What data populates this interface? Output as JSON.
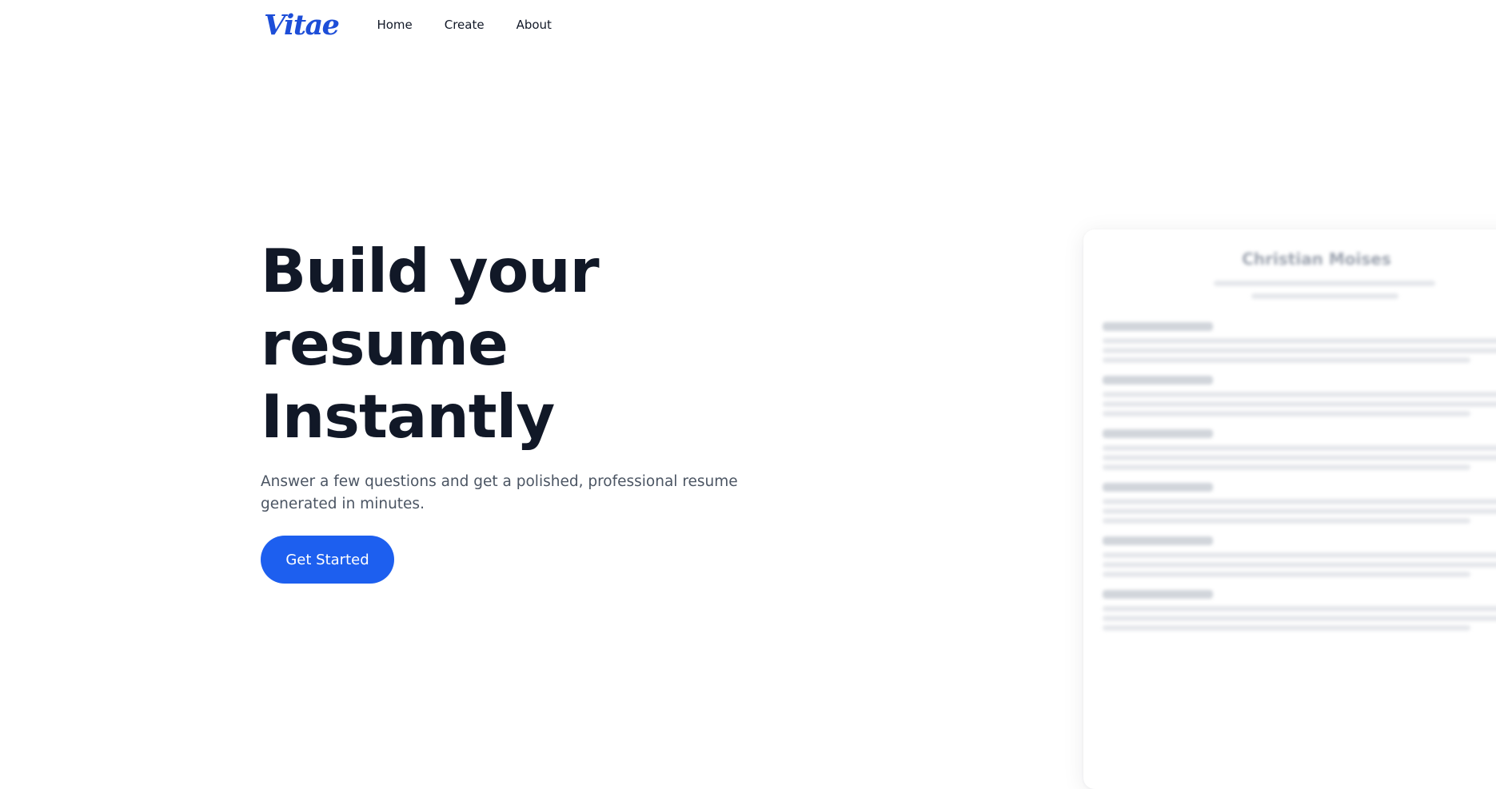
{
  "nav": {
    "logo": "Vitae",
    "links": [
      "Home",
      "Create",
      "About"
    ]
  },
  "hero": {
    "title_lines": [
      "Build your",
      "resume",
      "Instantly"
    ],
    "subtitle": "Answer a few questions and get a polished, professional resume generated in minutes.",
    "cta_label": "Get Started"
  },
  "preview": {
    "name": "Christian Moises"
  },
  "colors": {
    "brand": "#1d4ed8",
    "cta": "#1d5fef",
    "heading": "#111827",
    "body_text": "#4b5563",
    "placeholder_heading": "#d1d5db",
    "placeholder_line": "#e5e7eb"
  }
}
